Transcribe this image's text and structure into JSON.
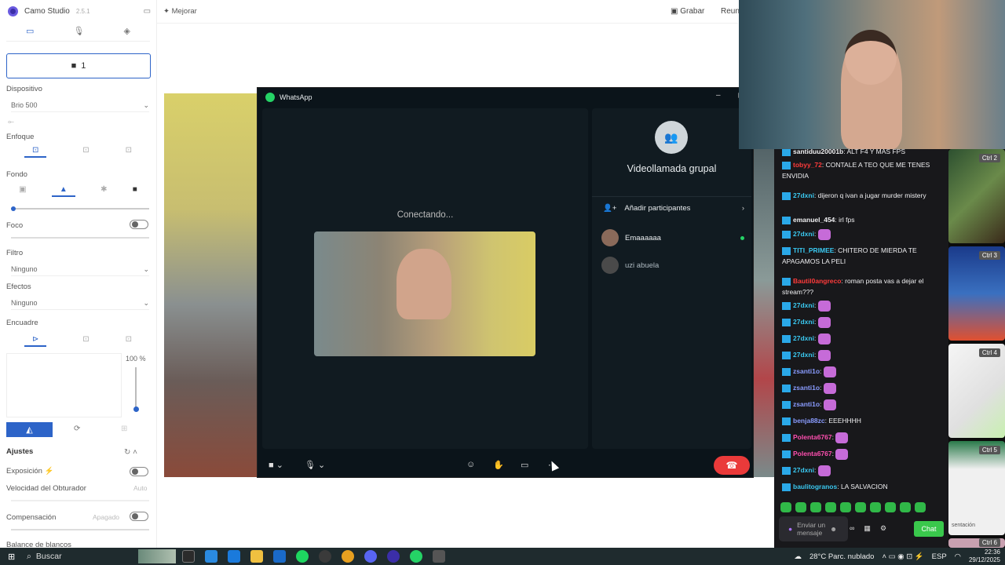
{
  "camo": {
    "app_name": "Camo Studio",
    "version": "2.5.1",
    "camera_label": "1",
    "device_label": "Dispositivo",
    "device_value": "Brio 500",
    "focus_section": "Enfoque",
    "background_section": "Fondo",
    "foco_label": "Foco",
    "filter_label": "Filtro",
    "filter_value": "Ninguno",
    "effects_label": "Efectos",
    "effects_value": "Ninguno",
    "framing_label": "Encuadre",
    "zoom_value": "100 %",
    "adjust_label": "Ajustes",
    "exposure_label": "Exposición",
    "shutter_label": "Velocidad del Obturador",
    "shutter_value": "Auto",
    "compensation_label": "Compensación",
    "compensation_value": "Apagado",
    "white_balance_label": "Balance de blancos",
    "enhance_label": "Mejorar",
    "record_label": "Grabar",
    "meeting_label": "Reuni"
  },
  "whatsapp": {
    "title": "WhatsApp",
    "status": "Conectando...",
    "call_title": "Videollamada grupal",
    "add_participants": "Añadir participantes",
    "participants": [
      {
        "name": "Emaaaaaa",
        "online": true
      },
      {
        "name": "uzi abuela",
        "online": false
      }
    ]
  },
  "chat": {
    "messages": [
      {
        "user": "santiduu20001b",
        "color": "#efeff1",
        "text": "ALT F4 Y MAS FPS"
      },
      {
        "user": "tobyy_72",
        "color": "#ff3b3b",
        "text": "CONTALE A TEO QUE ME TENES ENVIDIA"
      },
      {
        "user": "27dxni",
        "color": "#3ac8f0",
        "text": "dijeron q ivan a jugar murder mistery"
      },
      {
        "user": "emanuel_454",
        "color": "#efeff1",
        "text": "irl fps"
      },
      {
        "user": "27dxni",
        "color": "#3ac8f0",
        "text": ""
      },
      {
        "user": "TITI_PRIMEE",
        "color": "#3ac8f0",
        "text": "CHITERO DE MIERDA TE APAGAMOS LA PELI"
      },
      {
        "user": "Bautil0angreco",
        "color": "#ff3b3b",
        "text": "roman posta vas a dejar el stream???"
      },
      {
        "user": "27dxni",
        "color": "#3ac8f0",
        "text": ""
      },
      {
        "user": "27dxni",
        "color": "#3ac8f0",
        "text": ""
      },
      {
        "user": "27dxni",
        "color": "#3ac8f0",
        "text": ""
      },
      {
        "user": "27dxni",
        "color": "#3ac8f0",
        "text": ""
      },
      {
        "user": "zsanti1o",
        "color": "#8a9cff",
        "text": ""
      },
      {
        "user": "zsanti1o",
        "color": "#8a9cff",
        "text": ""
      },
      {
        "user": "zsanti1o",
        "color": "#8a9cff",
        "text": ""
      },
      {
        "user": "benja88zc",
        "color": "#8a9cff",
        "text": "EEEHHHH"
      },
      {
        "user": "Polenta6767",
        "color": "#ff4fb0",
        "text": ""
      },
      {
        "user": "Polenta6767",
        "color": "#ff4fb0",
        "text": ""
      },
      {
        "user": "27dxni",
        "color": "#3ac8f0",
        "text": ""
      },
      {
        "user": "baulitogranos",
        "color": "#3ac8f0",
        "text": "LA SALVACION"
      }
    ],
    "input_placeholder": "Enviar un mensaje",
    "send_label": "Chat"
  },
  "ctrl_panel": {
    "items": [
      "Ctrl 2",
      "Ctrl 3",
      "Ctrl 4",
      "Ctrl 5",
      "Ctrl 6"
    ],
    "slide_text": "sentación"
  },
  "taskbar": {
    "search": "Buscar",
    "weather": "28°C  Parc. nublado",
    "lang": "ESP",
    "time": "22:36",
    "date": "29/12/2025"
  }
}
